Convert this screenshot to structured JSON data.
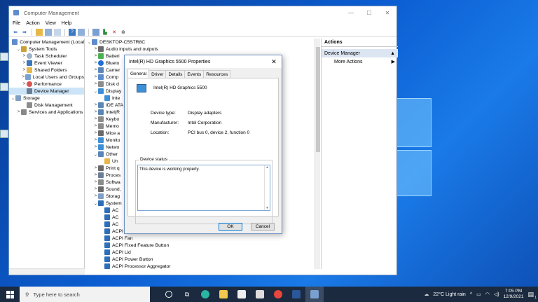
{
  "window": {
    "title": "Computer Management",
    "controls": {
      "minimize": "—",
      "maximize": "☐",
      "close": "✕"
    },
    "menu": [
      "File",
      "Action",
      "View",
      "Help"
    ]
  },
  "left_tree": [
    {
      "label": "Computer Management (Local",
      "exp": "",
      "icon": "comp",
      "indent": 0
    },
    {
      "label": "System Tools",
      "exp": "⌄",
      "icon": "tool",
      "indent": 1
    },
    {
      "label": "Task Scheduler",
      "exp": ">",
      "icon": "clock",
      "indent": 2
    },
    {
      "label": "Event Viewer",
      "exp": ">",
      "icon": "log",
      "indent": 2
    },
    {
      "label": "Shared Folders",
      "exp": ">",
      "icon": "folder",
      "indent": 2
    },
    {
      "label": "Local Users and Groups",
      "exp": ">",
      "icon": "users",
      "indent": 2
    },
    {
      "label": "Performance",
      "exp": ">",
      "icon": "perf",
      "indent": 2
    },
    {
      "label": "Device Manager",
      "exp": "",
      "icon": "dev",
      "indent": 2,
      "selected": true
    },
    {
      "label": "Storage",
      "exp": "⌄",
      "icon": "store",
      "indent": 0
    },
    {
      "label": "Disk Management",
      "exp": "",
      "icon": "disk",
      "indent": 2
    },
    {
      "label": "Services and Applications",
      "exp": ">",
      "icon": "svc",
      "indent": 1
    }
  ],
  "device_tree": [
    {
      "label": "DESKTOP-C5S7R8C",
      "exp": "⌄",
      "icon": "comp",
      "indent": 0
    },
    {
      "label": "Audio inputs and outputs",
      "exp": ">",
      "icon": "audio",
      "indent": 1
    },
    {
      "label": "Batteri",
      "exp": ">",
      "icon": "batt",
      "indent": 1
    },
    {
      "label": "Blueto",
      "exp": ">",
      "icon": "bt",
      "indent": 1
    },
    {
      "label": "Camer",
      "exp": ">",
      "icon": "generic",
      "indent": 1
    },
    {
      "label": "Comp",
      "exp": ">",
      "icon": "comp",
      "indent": 1
    },
    {
      "label": "Disk d",
      "exp": ">",
      "icon": "disk",
      "indent": 1
    },
    {
      "label": "Display",
      "exp": "⌄",
      "icon": "disp",
      "indent": 1
    },
    {
      "label": "Inte",
      "exp": "",
      "icon": "disp",
      "indent": 2
    },
    {
      "label": "IDE ATA",
      "exp": ">",
      "icon": "generic",
      "indent": 1
    },
    {
      "label": "Intel(R",
      "exp": ">",
      "icon": "generic",
      "indent": 1
    },
    {
      "label": "Keybo",
      "exp": ">",
      "icon": "disk",
      "indent": 1
    },
    {
      "label": "Memo",
      "exp": ">",
      "icon": "disk",
      "indent": 1
    },
    {
      "label": "Mice a",
      "exp": ">",
      "icon": "audio",
      "indent": 1
    },
    {
      "label": "Monito",
      "exp": ">",
      "icon": "disp",
      "indent": 1
    },
    {
      "label": "Netwo",
      "exp": ">",
      "icon": "disp",
      "indent": 1
    },
    {
      "label": "Other",
      "exp": "⌄",
      "icon": "generic",
      "indent": 1
    },
    {
      "label": "Un",
      "exp": "",
      "icon": "folder",
      "indent": 2
    },
    {
      "label": "Print q",
      "exp": ">",
      "icon": "audio",
      "indent": 1
    },
    {
      "label": "Proces",
      "exp": ">",
      "icon": "dev",
      "indent": 1
    },
    {
      "label": "Softwa",
      "exp": ">",
      "icon": "disk",
      "indent": 1
    },
    {
      "label": "Sound,",
      "exp": ">",
      "icon": "audio",
      "indent": 1
    },
    {
      "label": "Storag",
      "exp": ">",
      "icon": "store",
      "indent": 1
    },
    {
      "label": "System",
      "exp": "⌄",
      "icon": "sys",
      "indent": 1
    },
    {
      "label": "AC",
      "exp": "",
      "icon": "sys",
      "indent": 2
    },
    {
      "label": "AC",
      "exp": "",
      "icon": "sys",
      "indent": 2
    },
    {
      "label": "AC",
      "exp": "",
      "icon": "sys",
      "indent": 2
    },
    {
      "label": "ACPI Fan",
      "exp": "",
      "icon": "sys",
      "indent": 2
    },
    {
      "label": "ACPI Fan",
      "exp": "",
      "icon": "sys",
      "indent": 2
    },
    {
      "label": "ACPI Fixed Feature Button",
      "exp": "",
      "icon": "sys",
      "indent": 2
    },
    {
      "label": "ACPI Lid",
      "exp": "",
      "icon": "sys",
      "indent": 2
    },
    {
      "label": "ACPI Power Button",
      "exp": "",
      "icon": "sys",
      "indent": 2
    },
    {
      "label": "ACPI Processor Aggregator",
      "exp": "",
      "icon": "sys",
      "indent": 2
    }
  ],
  "actions": {
    "header": "Actions",
    "section": "Device Manager",
    "section_arrow": "▲",
    "item": "More Actions",
    "item_arrow": "▶"
  },
  "dialog": {
    "title": "Intel(R) HD Graphics 5500 Properties",
    "close": "✕",
    "tabs": [
      "General",
      "Driver",
      "Details",
      "Events",
      "Resources"
    ],
    "device_name": "Intel(R) HD Graphics 5500",
    "props": [
      {
        "label": "Device type:",
        "value": "Display adapters"
      },
      {
        "label": "Manufacturer:",
        "value": "Intel Corporation"
      },
      {
        "label": "Location:",
        "value": "PCI bus 0, device 2, function 0"
      }
    ],
    "status_group": "Device status",
    "status_text": "This device is working properly.",
    "ok": "OK",
    "cancel": "Cancel"
  },
  "taskbar": {
    "search_placeholder": "Type here to search",
    "weather": "22°C  Light rain",
    "time": "7:05 PM",
    "date": "12/9/2021",
    "notifications": "1"
  }
}
